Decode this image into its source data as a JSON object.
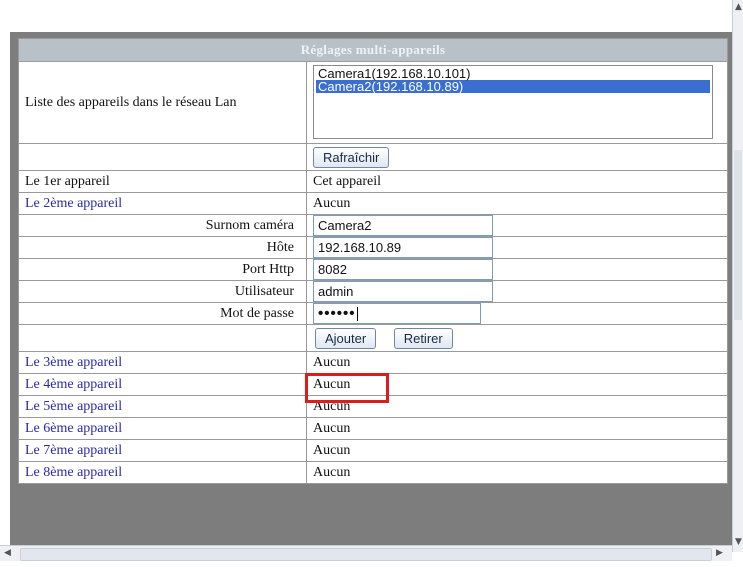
{
  "panel": {
    "title": "Réglages multi-appareils"
  },
  "device_list": {
    "label": "Liste des appareils dans le réseau Lan",
    "items": [
      {
        "label": "Camera1(192.168.10.101)",
        "selected": false
      },
      {
        "label": "Camera2(192.168.10.89)",
        "selected": true
      }
    ],
    "refresh_label": "Rafraîchir"
  },
  "device1": {
    "label": "Le 1er appareil",
    "value": "Cet appareil"
  },
  "device2": {
    "label": "Le 2ème appareil",
    "value": "Aucun",
    "form": {
      "alias_label": "Surnom caméra",
      "alias_value": "Camera2",
      "host_label": "Hôte",
      "host_value": "192.168.10.89",
      "port_label": "Port Http",
      "port_value": "8082",
      "user_label": "Utilisateur",
      "user_value": "admin",
      "password_label": "Mot de passe",
      "password_value": "••••••"
    },
    "add_label": "Ajouter",
    "remove_label": "Retirer"
  },
  "other_devices": [
    {
      "label": "Le 3ème appareil",
      "value": "Aucun"
    },
    {
      "label": "Le 4ème appareil",
      "value": "Aucun"
    },
    {
      "label": "Le 5ème appareil",
      "value": "Aucun"
    },
    {
      "label": "Le 6ème appareil",
      "value": "Aucun"
    },
    {
      "label": "Le 7ème appareil",
      "value": "Aucun"
    },
    {
      "label": "Le 8ème appareil",
      "value": "Aucun"
    }
  ],
  "colors": {
    "frame": "#7d7d7d",
    "header_bg": "#b9c1c8",
    "link": "#2a2aa8",
    "selection": "#3a6ed0",
    "highlight": "#dd1c1c"
  },
  "icons": {
    "scroll_up": "chevron-up-icon",
    "scroll_down": "chevron-down-icon",
    "scroll_left": "chevron-left-icon",
    "scroll_right": "chevron-right-icon"
  }
}
